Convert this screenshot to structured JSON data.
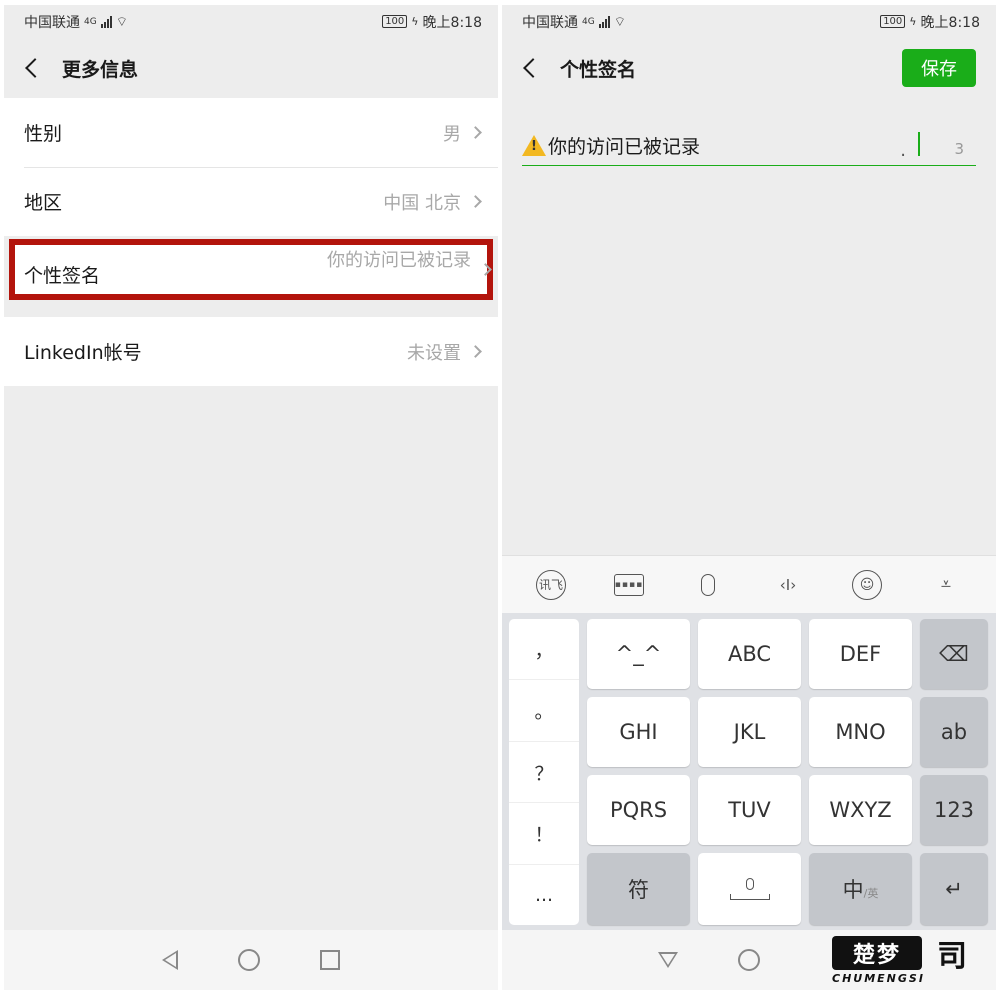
{
  "left": {
    "status": {
      "carrier": "中国联通",
      "network": "4G",
      "battery": "100",
      "time": "晚上8:18"
    },
    "title": "更多信息",
    "rows": [
      {
        "label": "性别",
        "value": "男"
      },
      {
        "label": "地区",
        "value": "中国 北京"
      },
      {
        "label": "个性签名",
        "value": "你的访问已被记录"
      },
      {
        "label": "LinkedIn帐号",
        "value": "未设置"
      }
    ]
  },
  "right": {
    "status": {
      "carrier": "中国联通",
      "network": "4G",
      "battery": "100",
      "time": "晚上8:18"
    },
    "title": "个性签名",
    "save_label": "保存",
    "editor_text": "你的访问已被记录",
    "editor_dot": ".",
    "char_count": "3",
    "toolbar": [
      "ifly-icon",
      "keyboard-icon",
      "mic-icon",
      "cursor-move-icon",
      "emoji-icon",
      "hide-keyboard-icon"
    ],
    "punct_keys": [
      "，",
      "。",
      "？",
      "！",
      "..."
    ],
    "keys": {
      "k1": "^_^",
      "k2": "ABC",
      "k3": "DEF",
      "del": "⌫",
      "k4": "GHI",
      "k5": "JKL",
      "k6": "MNO",
      "ab": "ab",
      "k7": "PQRS",
      "k8": "TUV",
      "k9": "WXYZ",
      "num": "123",
      "sym": "符",
      "space": "",
      "lang": "中",
      "lang_sub": "/英",
      "enter": "↵"
    }
  },
  "watermark": {
    "logo": "楚梦",
    "logo2": "司",
    "text": "CHUMENGSI"
  }
}
